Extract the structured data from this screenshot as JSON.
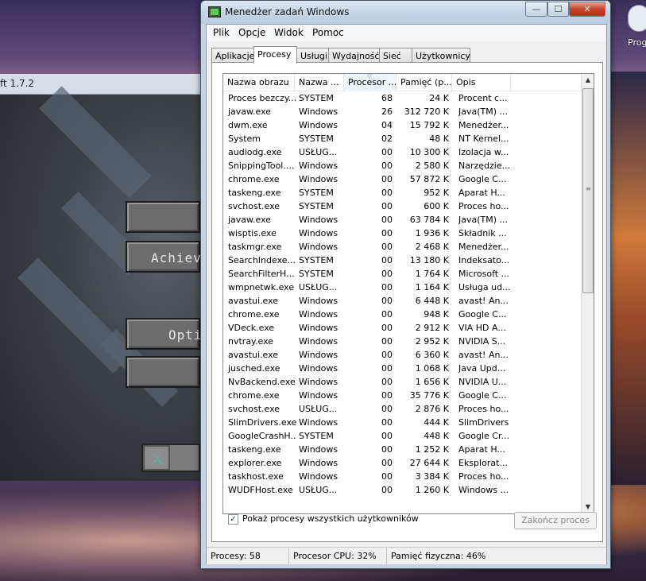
{
  "background_app": {
    "title_fragment": "ft 1.7.2",
    "buttons": [
      "Achiev",
      "Opti"
    ],
    "desktop_icon_label": "Prog"
  },
  "window": {
    "title": "Menedżer zadań Windows",
    "controls": {
      "minimize": "—",
      "maximize": "☐",
      "close": "✕"
    }
  },
  "menu": [
    "Plik",
    "Opcje",
    "Widok",
    "Pomoc"
  ],
  "tabs": [
    {
      "label": "Aplikacje"
    },
    {
      "label": "Procesy",
      "active": true
    },
    {
      "label": "Usługi"
    },
    {
      "label": "Wydajność"
    },
    {
      "label": "Sieć"
    },
    {
      "label": "Użytkownicy"
    }
  ],
  "columns": [
    "Nazwa obrazu",
    "Nazwa ...",
    "Procesor ...",
    "Pamięć (p...",
    "Opis"
  ],
  "processes": [
    [
      "Proces bezczy...",
      "SYSTEM",
      "68",
      "24 K",
      "Procent c..."
    ],
    [
      "javaw.exe",
      "Windows",
      "26",
      "312 720 K",
      "Java(TM) ..."
    ],
    [
      "dwm.exe",
      "Windows",
      "04",
      "15 792 K",
      "Menedżer..."
    ],
    [
      "System",
      "SYSTEM",
      "02",
      "48 K",
      "NT Kernel..."
    ],
    [
      "audiodg.exe",
      "USŁUG...",
      "00",
      "10 300 K",
      "Izolacja w..."
    ],
    [
      "SnippingTool....",
      "Windows",
      "00",
      "2 580 K",
      "Narzędzie..."
    ],
    [
      "chrome.exe",
      "Windows",
      "00",
      "57 872 K",
      "Google C..."
    ],
    [
      "taskeng.exe",
      "SYSTEM",
      "00",
      "952 K",
      "Aparat H..."
    ],
    [
      "svchost.exe",
      "SYSTEM",
      "00",
      "600 K",
      "Proces ho..."
    ],
    [
      "javaw.exe",
      "Windows",
      "00",
      "63 784 K",
      "Java(TM) ..."
    ],
    [
      "wisptis.exe",
      "Windows",
      "00",
      "1 936 K",
      "Składnik ..."
    ],
    [
      "taskmgr.exe",
      "Windows",
      "00",
      "2 468 K",
      "Menedżer..."
    ],
    [
      "SearchIndexe...",
      "SYSTEM",
      "00",
      "13 180 K",
      "Indeksato..."
    ],
    [
      "SearchFilterH...",
      "SYSTEM",
      "00",
      "1 764 K",
      "Microsoft ..."
    ],
    [
      "wmpnetwk.exe",
      "USŁUG...",
      "00",
      "1 164 K",
      "Usługa ud..."
    ],
    [
      "avastui.exe",
      "Windows",
      "00",
      "6 448 K",
      "avast! An..."
    ],
    [
      "chrome.exe",
      "Windows",
      "00",
      "948 K",
      "Google C..."
    ],
    [
      "VDeck.exe",
      "Windows",
      "00",
      "2 912 K",
      "VIA HD A..."
    ],
    [
      "nvtray.exe",
      "Windows",
      "00",
      "2 952 K",
      "NVIDIA S..."
    ],
    [
      "avastui.exe",
      "Windows",
      "00",
      "6 360 K",
      "avast! An..."
    ],
    [
      "jusched.exe",
      "Windows",
      "00",
      "1 068 K",
      "Java Upd..."
    ],
    [
      "NvBackend.exe",
      "Windows",
      "00",
      "1 656 K",
      "NVIDIA U..."
    ],
    [
      "chrome.exe",
      "Windows",
      "00",
      "35 776 K",
      "Google C..."
    ],
    [
      "svchost.exe",
      "USŁUG...",
      "00",
      "2 876 K",
      "Proces ho..."
    ],
    [
      "SlimDrivers.exe",
      "Windows",
      "00",
      "444 K",
      "SlimDrivers"
    ],
    [
      "GoogleCrashH...",
      "SYSTEM",
      "00",
      "448 K",
      "Google Cr..."
    ],
    [
      "taskeng.exe",
      "Windows",
      "00",
      "1 252 K",
      "Aparat H..."
    ],
    [
      "explorer.exe",
      "Windows",
      "00",
      "27 644 K",
      "Eksplorat..."
    ],
    [
      "taskhost.exe",
      "Windows",
      "00",
      "3 384 K",
      "Proces ho..."
    ],
    [
      "WUDFHost.exe",
      "USŁUG...",
      "00",
      "1 260 K",
      "Windows ..."
    ]
  ],
  "show_all_users": {
    "label": "Pokaż procesy wszystkich użytkowników",
    "checked": true
  },
  "end_process_label": "Zakończ proces",
  "status": {
    "processes": "Procesy: 58",
    "cpu": "Procesor CPU: 32%",
    "memory": "Pamięć fizyczna: 46%"
  },
  "icons": {
    "check": "✓",
    "scroll_up": "▲",
    "scroll_down": "▼",
    "sort": "▽",
    "grip": "≡",
    "sword": "⚔"
  }
}
